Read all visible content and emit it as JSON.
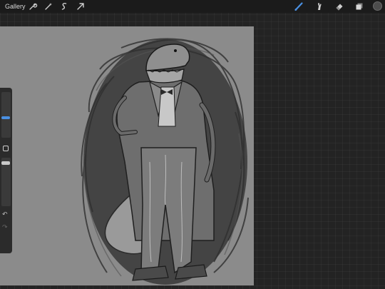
{
  "topbar": {
    "gallery_label": "Gallery",
    "left_tools": [
      "wrench-icon",
      "magic-wand-icon",
      "selection-icon",
      "transform-arrow-icon"
    ],
    "right_tools": [
      "brush-icon",
      "smudge-icon",
      "eraser-icon",
      "layers-icon"
    ],
    "active_tool": "brush-icon",
    "accent_color": "#4a90e2",
    "current_color": "#4d4d4d"
  },
  "sidebar": {
    "controls": [
      "brush-size-slider",
      "modify-button",
      "opacity-slider",
      "undo-button",
      "redo-button"
    ]
  },
  "canvas": {
    "background_color": "#8b8b8b",
    "description_tag": "crocodile-in-suit-sketch"
  },
  "theme": {
    "app_background": "#232323",
    "topbar_background": "#1b1b1b"
  }
}
